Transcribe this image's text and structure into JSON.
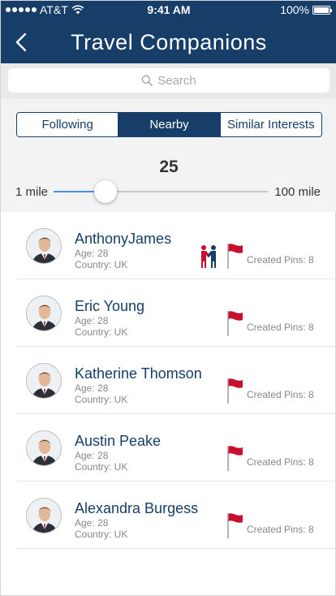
{
  "status": {
    "carrier": "AT&T",
    "time": "9:41 AM",
    "battery": "100%",
    "battery_level": 1.0
  },
  "nav": {
    "title": "Travel Companions",
    "back_icon": "chevron-left-icon"
  },
  "search": {
    "placeholder": "Search"
  },
  "tabs": [
    {
      "label": "Following",
      "active": false
    },
    {
      "label": "Nearby",
      "active": true
    },
    {
      "label": "Similar Interests",
      "active": false
    }
  ],
  "distance": {
    "value": "25",
    "min_label": "1 mile",
    "max_label": "100 mile",
    "min": 1,
    "max": 100,
    "current": 25
  },
  "people": [
    {
      "name": "AnthonyJames",
      "age": "Age: 28",
      "country": "Country: UK",
      "pins": "Created Pins: 8",
      "connected": true
    },
    {
      "name": "Eric Young",
      "age": "Age: 28",
      "country": "Country: UK",
      "pins": "Created Pins: 8",
      "connected": false
    },
    {
      "name": "Katherine Thomson",
      "age": "Age: 28",
      "country": "Country: UK",
      "pins": "Created Pins: 8",
      "connected": false
    },
    {
      "name": "Austin Peake",
      "age": "Age: 28",
      "country": "Country: UK",
      "pins": "Created Pins: 8",
      "connected": false
    },
    {
      "name": "Alexandra Burgess",
      "age": "Age: 28",
      "country": "Country: UK",
      "pins": "Created Pins: 8",
      "connected": false
    }
  ],
  "colors": {
    "brand": "#173e69",
    "slider_fill": "#4a90e2",
    "flag": "#c8102e"
  }
}
